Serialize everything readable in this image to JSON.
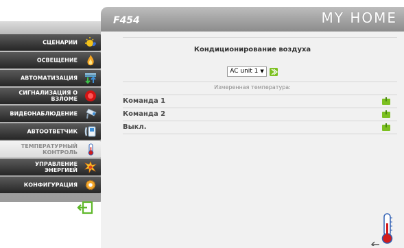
{
  "sidebar": {
    "items": [
      {
        "label": "СЦЕНАРИИ",
        "icon": "scenario-sun-icon",
        "active": false
      },
      {
        "label": "ОСВЕЩЕНИЕ",
        "icon": "lighting-flame-icon",
        "active": false
      },
      {
        "label": "АВТОМАТИЗАЦИЯ",
        "icon": "automation-arrows-icon",
        "active": false
      },
      {
        "label": "СИГНАЛИЗАЦИЯ О ВЗЛОМЕ",
        "icon": "alarm-icon",
        "active": false
      },
      {
        "label": "ВИДЕОНАБЛЮДЕНИЕ",
        "icon": "video-camera-icon",
        "active": false
      },
      {
        "label": "АВТООТВЕТЧИК",
        "icon": "answering-machine-icon",
        "active": false
      },
      {
        "label": "ТЕМПЕРАТУРНЫЙ КОНТРОЛЬ",
        "icon": "thermometer-icon",
        "active": true
      },
      {
        "label": "УПРАВЛЕНИЕ ЭНЕРГИЕЙ",
        "icon": "energy-icon",
        "active": false
      },
      {
        "label": "КОНФИГУРАЦИЯ",
        "icon": "configuration-gear-icon",
        "active": false
      }
    ]
  },
  "header": {
    "device": "F454",
    "brand": "MY HOME"
  },
  "main": {
    "title": "Кондиционирование воздуха",
    "unit_select": {
      "value": "AC unit 1"
    },
    "measured_temperature_label": "Измеренная температура:",
    "commands": [
      {
        "label": "Команда 1"
      },
      {
        "label": "Команда 2"
      },
      {
        "label": "Выкл."
      }
    ]
  },
  "colors": {
    "accent_green": "#7cc020",
    "menu_dark": "#2e2e2e",
    "panel_bg": "#f1f1f1"
  }
}
